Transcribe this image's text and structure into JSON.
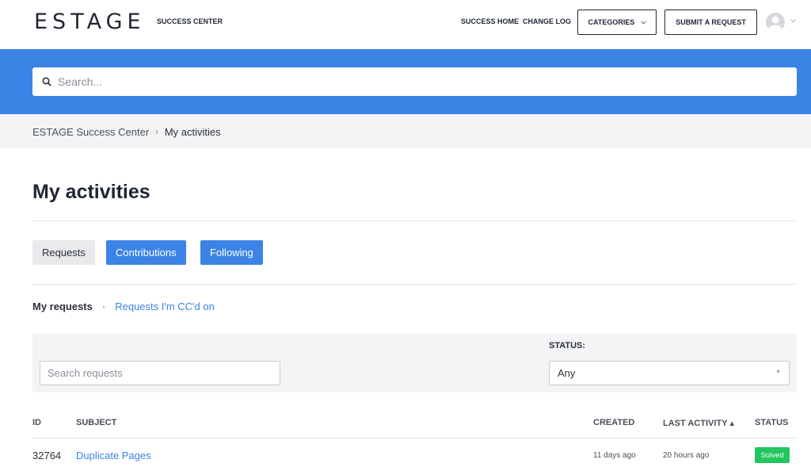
{
  "header": {
    "logo": "ESTAGE",
    "brand_sub": "SUCCESS CENTER",
    "nav": {
      "success_home": "SUCCESS HOME",
      "change_log": "CHANGE LOG",
      "categories": "CATEGORIES",
      "submit_request": "SUBMIT A REQUEST"
    }
  },
  "search": {
    "placeholder": "Search..."
  },
  "breadcrumb": {
    "root": "ESTAGE Success Center",
    "separator": "›",
    "current": "My activities"
  },
  "page": {
    "title": "My activities"
  },
  "tabs": {
    "requests": "Requests",
    "contributions": "Contributions",
    "following": "Following"
  },
  "subnav": {
    "my_requests": "My requests",
    "dot": "·",
    "cc_requests": "Requests I'm CC'd on"
  },
  "filters": {
    "search_placeholder": "Search requests",
    "status_label": "STATUS:",
    "status_value": "Any"
  },
  "table": {
    "headers": {
      "id": "ID",
      "subject": "SUBJECT",
      "created": "CREATED",
      "last_activity": "LAST ACTIVITY ▴",
      "status": "STATUS"
    },
    "rows": [
      {
        "id": "32764",
        "subject": "Duplicate Pages",
        "created": "11 days ago",
        "last_activity": "20 hours ago",
        "status": "Solved"
      }
    ]
  },
  "colors": {
    "accent": "#3c83e6",
    "solved": "#22c55e",
    "text_dark": "#1f2634"
  }
}
